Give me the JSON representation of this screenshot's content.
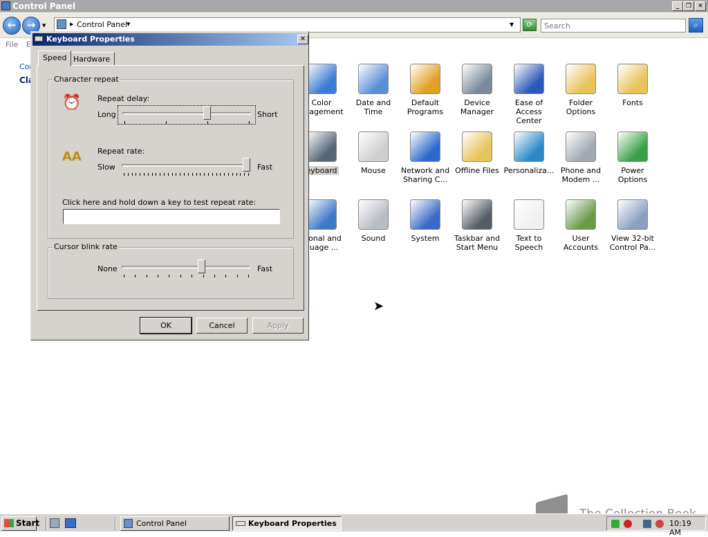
{
  "window": {
    "title": "Control Panel"
  },
  "address": {
    "crumb": "Control Panel",
    "search_placeholder": "Search"
  },
  "menu": {
    "file": "File",
    "edit_partial": "E"
  },
  "left_pane": {
    "link_partial": "Cor",
    "classic_partial": "Cla"
  },
  "items": [
    {
      "label": "Color\nanagement",
      "icon": "color-management-icon"
    },
    {
      "label": "Date and Time",
      "icon": "date-time-icon"
    },
    {
      "label": "Default\nPrograms",
      "icon": "default-programs-icon"
    },
    {
      "label": "Device\nManager",
      "icon": "device-manager-icon"
    },
    {
      "label": "Ease of\nAccess Center",
      "icon": "ease-of-access-icon"
    },
    {
      "label": "Folder Options",
      "icon": "folder-options-icon"
    },
    {
      "label": "Fonts",
      "icon": "fonts-icon"
    },
    {
      "label": "eyboard",
      "icon": "keyboard-icon"
    },
    {
      "label": "Mouse",
      "icon": "mouse-icon"
    },
    {
      "label": "Network and\nSharing C...",
      "icon": "network-icon"
    },
    {
      "label": "Offline Files",
      "icon": "offline-files-icon"
    },
    {
      "label": "Personaliza...",
      "icon": "personalization-icon"
    },
    {
      "label": "Phone and\nModem ...",
      "icon": "phone-modem-icon"
    },
    {
      "label": "Power Options",
      "icon": "power-options-icon"
    },
    {
      "label": "gional and\nguage ...",
      "icon": "regional-icon"
    },
    {
      "label": "Sound",
      "icon": "sound-icon"
    },
    {
      "label": "System",
      "icon": "system-icon"
    },
    {
      "label": "Taskbar and\nStart Menu",
      "icon": "taskbar-icon"
    },
    {
      "label": "Text to\nSpeech",
      "icon": "text-to-speech-icon"
    },
    {
      "label": "User Accounts",
      "icon": "user-accounts-icon"
    },
    {
      "label": "View 32-bit\nControl Pa...",
      "icon": "view-32bit-icon"
    }
  ],
  "dialog": {
    "title": "Keyboard Properties",
    "tabs": [
      "Speed",
      "Hardware"
    ],
    "char_repeat": {
      "group": "Character repeat",
      "delay_label": "Repeat delay:",
      "delay_min": "Long",
      "delay_max": "Short",
      "delay_value": 0.67,
      "rate_label": "Repeat rate:",
      "rate_min": "Slow",
      "rate_max": "Fast",
      "rate_value": 1.0,
      "test_label": "Click here and hold down a key to test repeat rate:",
      "test_value": ""
    },
    "cursor": {
      "group": "Cursor blink rate",
      "min": "None",
      "max": "Fast",
      "value": 0.63
    },
    "buttons": {
      "ok": "OK",
      "cancel": "Cancel",
      "apply": "Apply"
    }
  },
  "taskbar": {
    "start": "Start",
    "tasks": [
      "Control Panel",
      "Keyboard Properties"
    ],
    "clock": "10:19 AM"
  },
  "watermark": "The Collection Book"
}
